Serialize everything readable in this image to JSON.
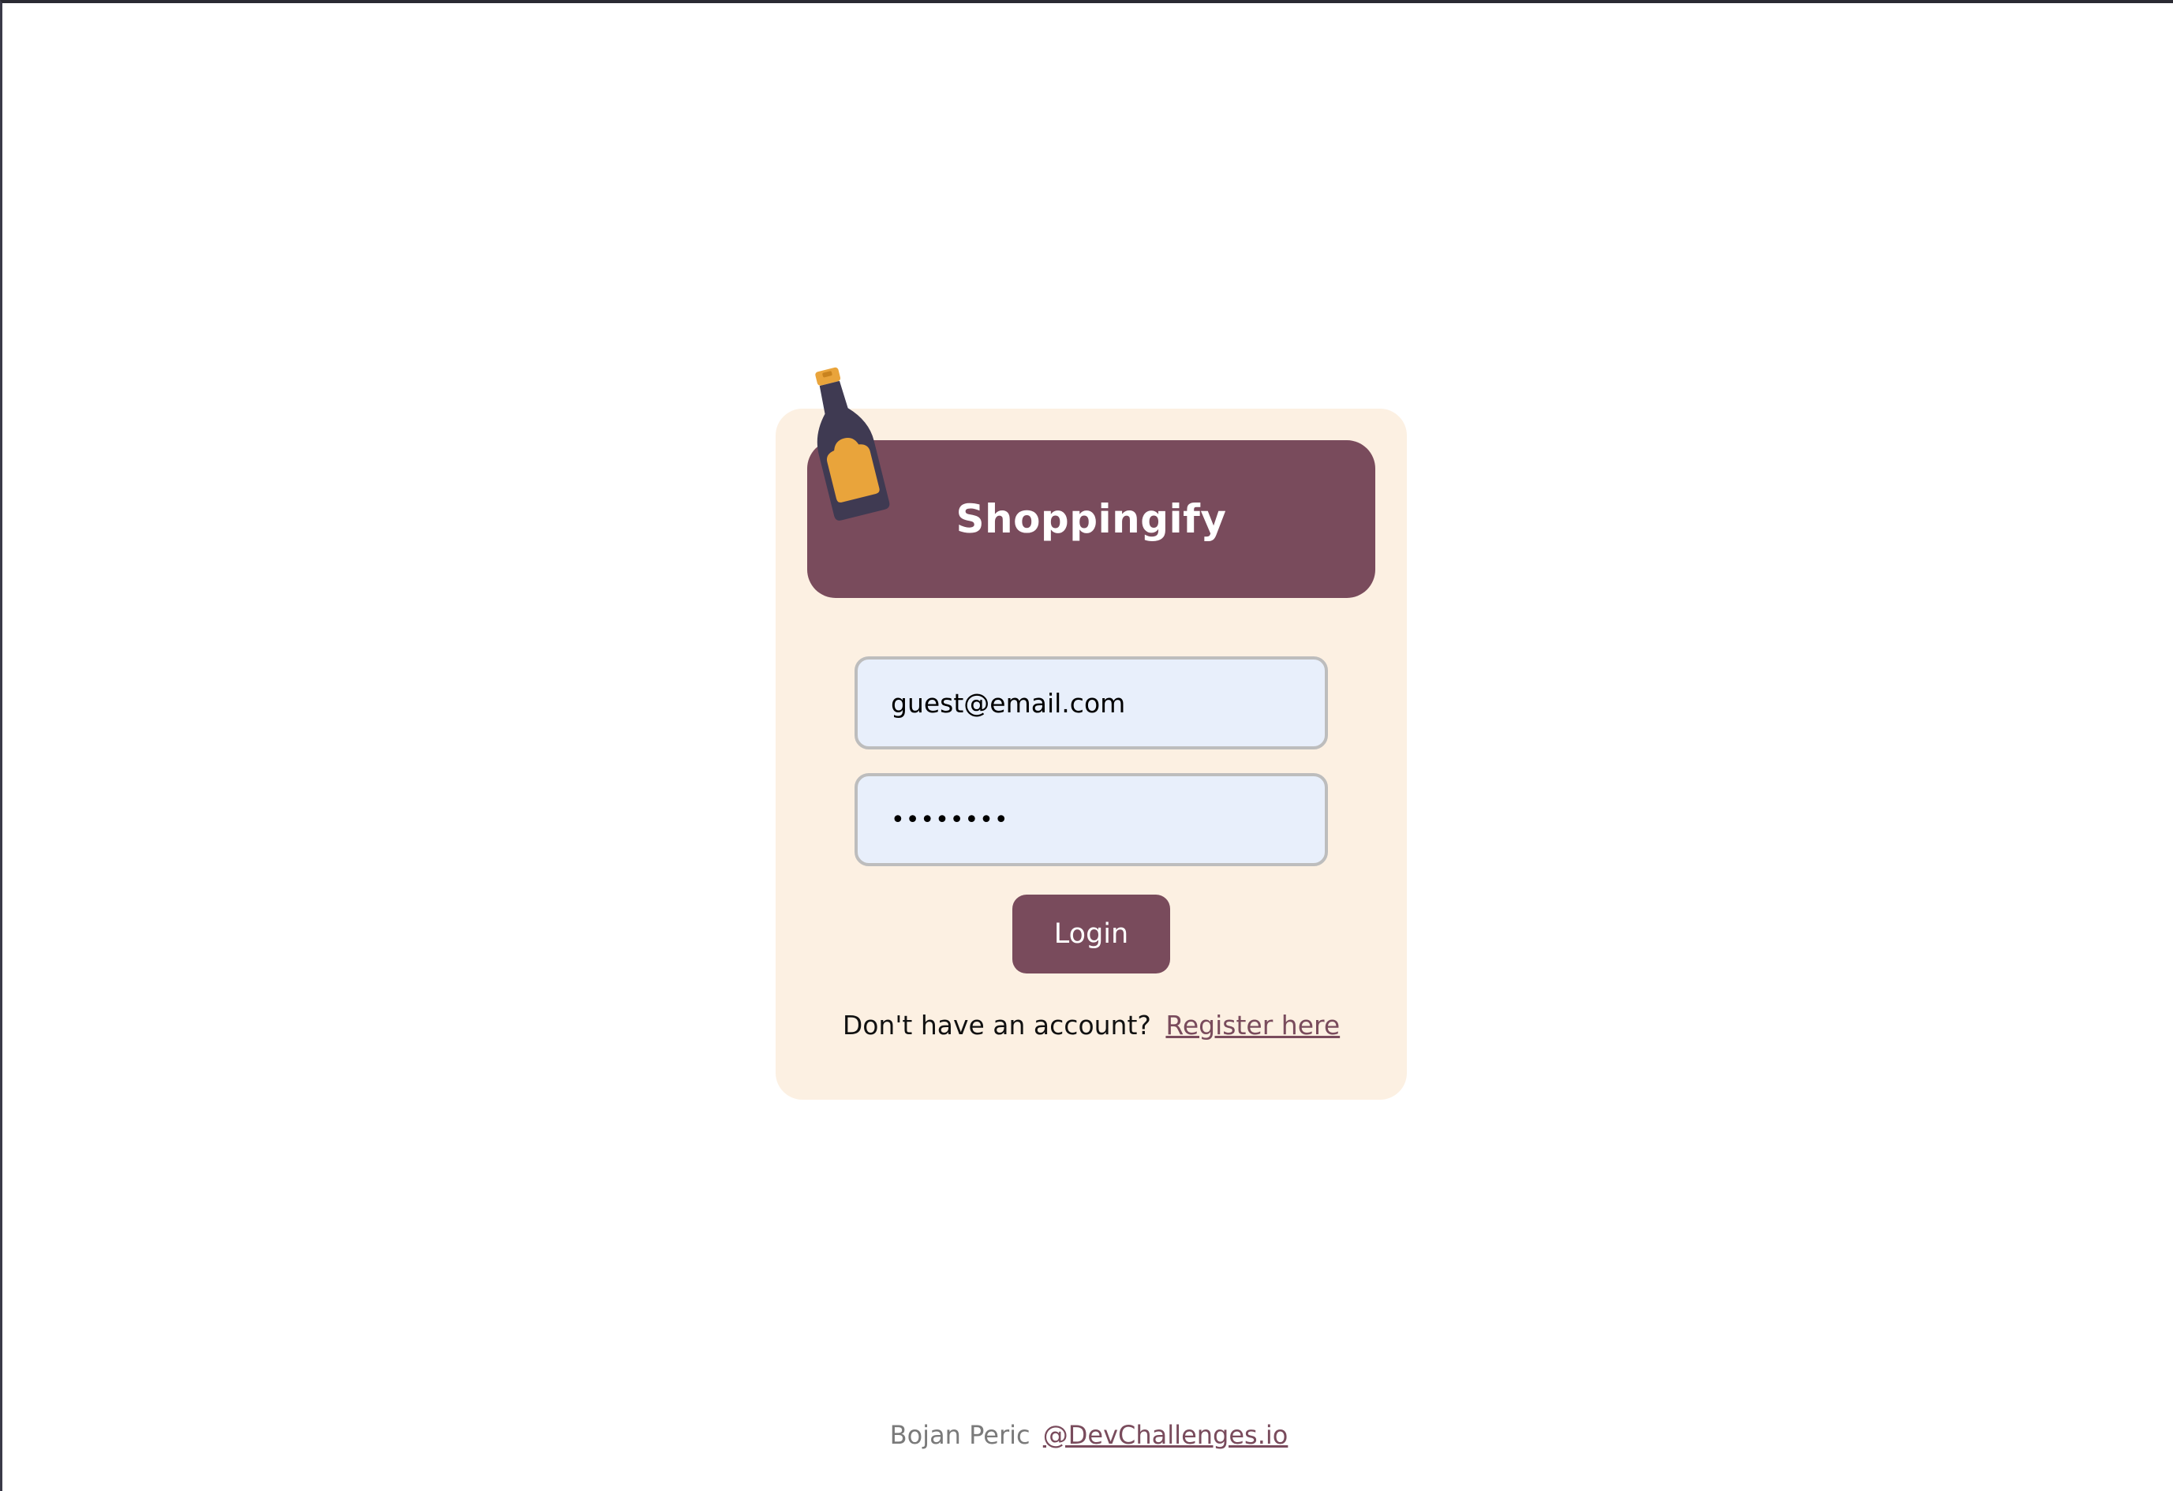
{
  "app": {
    "title": "Shoppingify"
  },
  "login_form": {
    "email_value": "guest@email.com",
    "password_value": "••••••••",
    "login_label": "Login",
    "register_prompt": "Don't have an account?",
    "register_link": "Register here"
  },
  "footer": {
    "author": "Bojan Peric",
    "link": "@DevChallenges.io"
  },
  "colors": {
    "accent": "#794b5c",
    "card_background": "#fcf0e2",
    "input_background": "#e8effb",
    "bottle": "#3f3a52",
    "bottle_label": "#e9a43b"
  },
  "icons": {
    "logo": "bottle-icon"
  }
}
